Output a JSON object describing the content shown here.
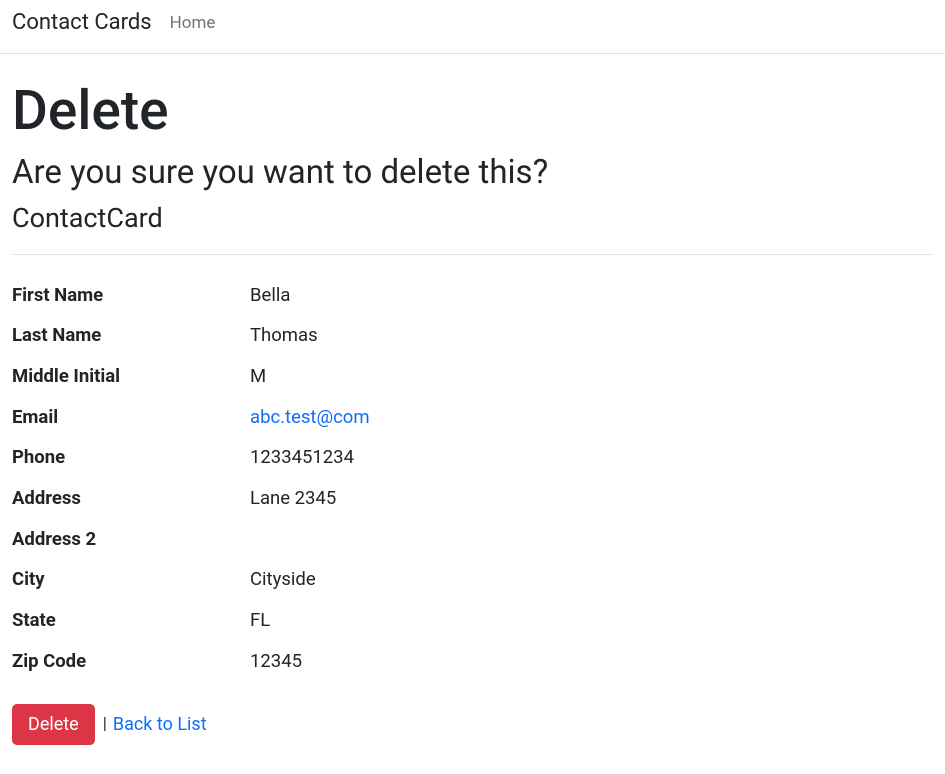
{
  "nav": {
    "brand": "Contact Cards",
    "home": "Home"
  },
  "page": {
    "title": "Delete",
    "confirm": "Are you sure you want to delete this?",
    "entity": "ContactCard"
  },
  "labels": {
    "firstName": "First Name",
    "lastName": "Last Name",
    "middleInitial": "Middle Initial",
    "email": "Email",
    "phone": "Phone",
    "address": "Address",
    "address2": "Address 2",
    "city": "City",
    "state": "State",
    "zipCode": "Zip Code"
  },
  "values": {
    "firstName": "Bella",
    "lastName": "Thomas",
    "middleInitial": "M",
    "email": "abc.test@com",
    "phone": "1233451234",
    "address": "Lane 2345",
    "address2": "",
    "city": "Cityside",
    "state": "FL",
    "zipCode": "12345"
  },
  "actions": {
    "delete": "Delete",
    "separator": "|",
    "backToList": "Back to List"
  }
}
